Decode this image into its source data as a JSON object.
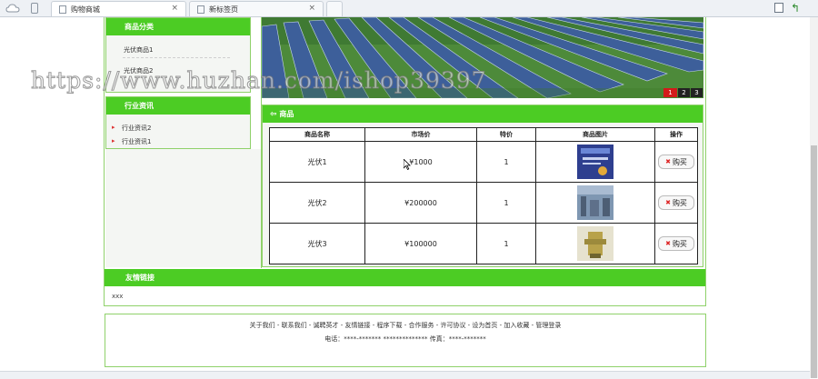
{
  "browser": {
    "tabs": [
      {
        "label": "购物商城",
        "close": "×"
      },
      {
        "label": "新标签页",
        "close": "×"
      }
    ]
  },
  "sidebar": {
    "category_title": "商品分类",
    "categories": [
      "光伏商品1",
      "光伏商品2"
    ],
    "news_title": "行业资讯",
    "news": [
      "行业资讯2",
      "行业资讯1"
    ],
    "bullet": "▸"
  },
  "banner": {
    "pages": [
      "1",
      "2",
      "3"
    ],
    "active_page": "1"
  },
  "products": {
    "title": "商品",
    "headers": [
      "商品名称",
      "市场价",
      "特价",
      "商品图片",
      "操作"
    ],
    "rows": [
      {
        "name": "光伏1",
        "market_price": "¥1000",
        "special": "1",
        "buy": "购买"
      },
      {
        "name": "光伏2",
        "market_price": "¥200000",
        "special": "1",
        "buy": "购买"
      },
      {
        "name": "光伏3",
        "market_price": "¥100000",
        "special": "1",
        "buy": "购买"
      }
    ]
  },
  "links": {
    "title": "友情链接",
    "content": "xxx"
  },
  "footer": {
    "nav": "关于我们 - 联系我们 - 诚聘英才 - 友情链接 - 程序下载 - 合作服务 - 许可协议 - 设为首页 - 加入收藏 - 管理登录",
    "contact": "电话：****-*******  ************** 传真：****-*******"
  },
  "watermark": "https://www.huzhan.com/ishop39397",
  "colors": {
    "accent_green": "#4ccc24",
    "border_green": "#8fd16a",
    "pager_active": "#d21a1a"
  }
}
